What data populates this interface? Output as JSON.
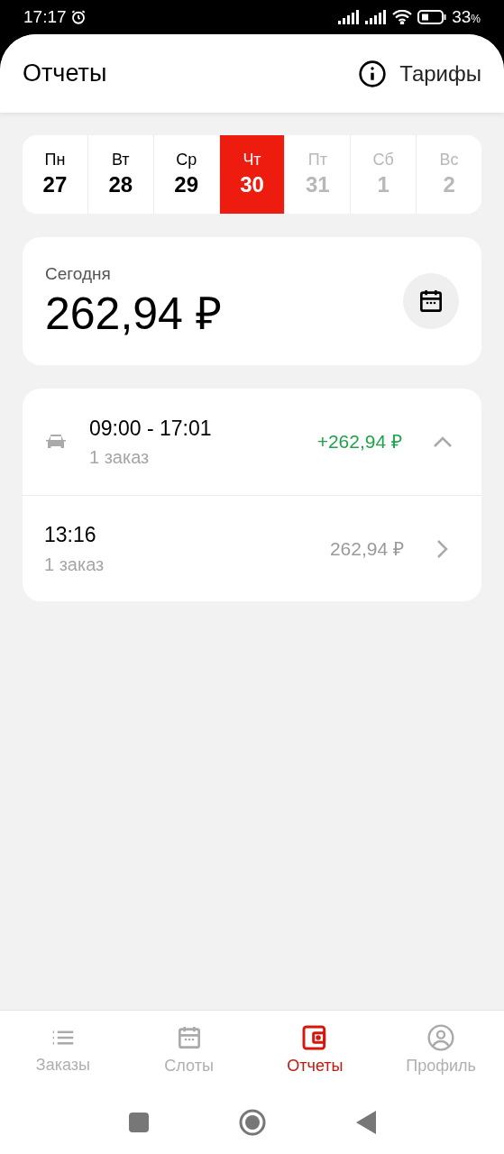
{
  "status_bar": {
    "time": "17:17",
    "battery": "33",
    "battery_unit": "%"
  },
  "header": {
    "title": "Отчеты",
    "link": "Тарифы"
  },
  "week": [
    {
      "weekday": "Пн",
      "day": "27",
      "selected": false,
      "disabled": false
    },
    {
      "weekday": "Вт",
      "day": "28",
      "selected": false,
      "disabled": false
    },
    {
      "weekday": "Ср",
      "day": "29",
      "selected": false,
      "disabled": false
    },
    {
      "weekday": "Чт",
      "day": "30",
      "selected": true,
      "disabled": false
    },
    {
      "weekday": "Пт",
      "day": "31",
      "selected": false,
      "disabled": true
    },
    {
      "weekday": "Сб",
      "day": "1",
      "selected": false,
      "disabled": true
    },
    {
      "weekday": "Вс",
      "day": "2",
      "selected": false,
      "disabled": true
    }
  ],
  "summary": {
    "label": "Сегодня",
    "amount": "262,94 ₽"
  },
  "shift": {
    "time_range": "09:00 - 17:01",
    "orders": "1 заказ",
    "total": "+262,94 ₽",
    "expanded": true
  },
  "entries": [
    {
      "time": "13:16",
      "orders": "1 заказ",
      "total": "262,94 ₽"
    }
  ],
  "bottom_nav": [
    {
      "kind": "list",
      "label": "Заказы",
      "selected": false
    },
    {
      "kind": "calendar",
      "label": "Слоты",
      "selected": false
    },
    {
      "kind": "wallet",
      "label": "Отчеты",
      "selected": true
    },
    {
      "kind": "profile",
      "label": "Профиль",
      "selected": false
    }
  ]
}
